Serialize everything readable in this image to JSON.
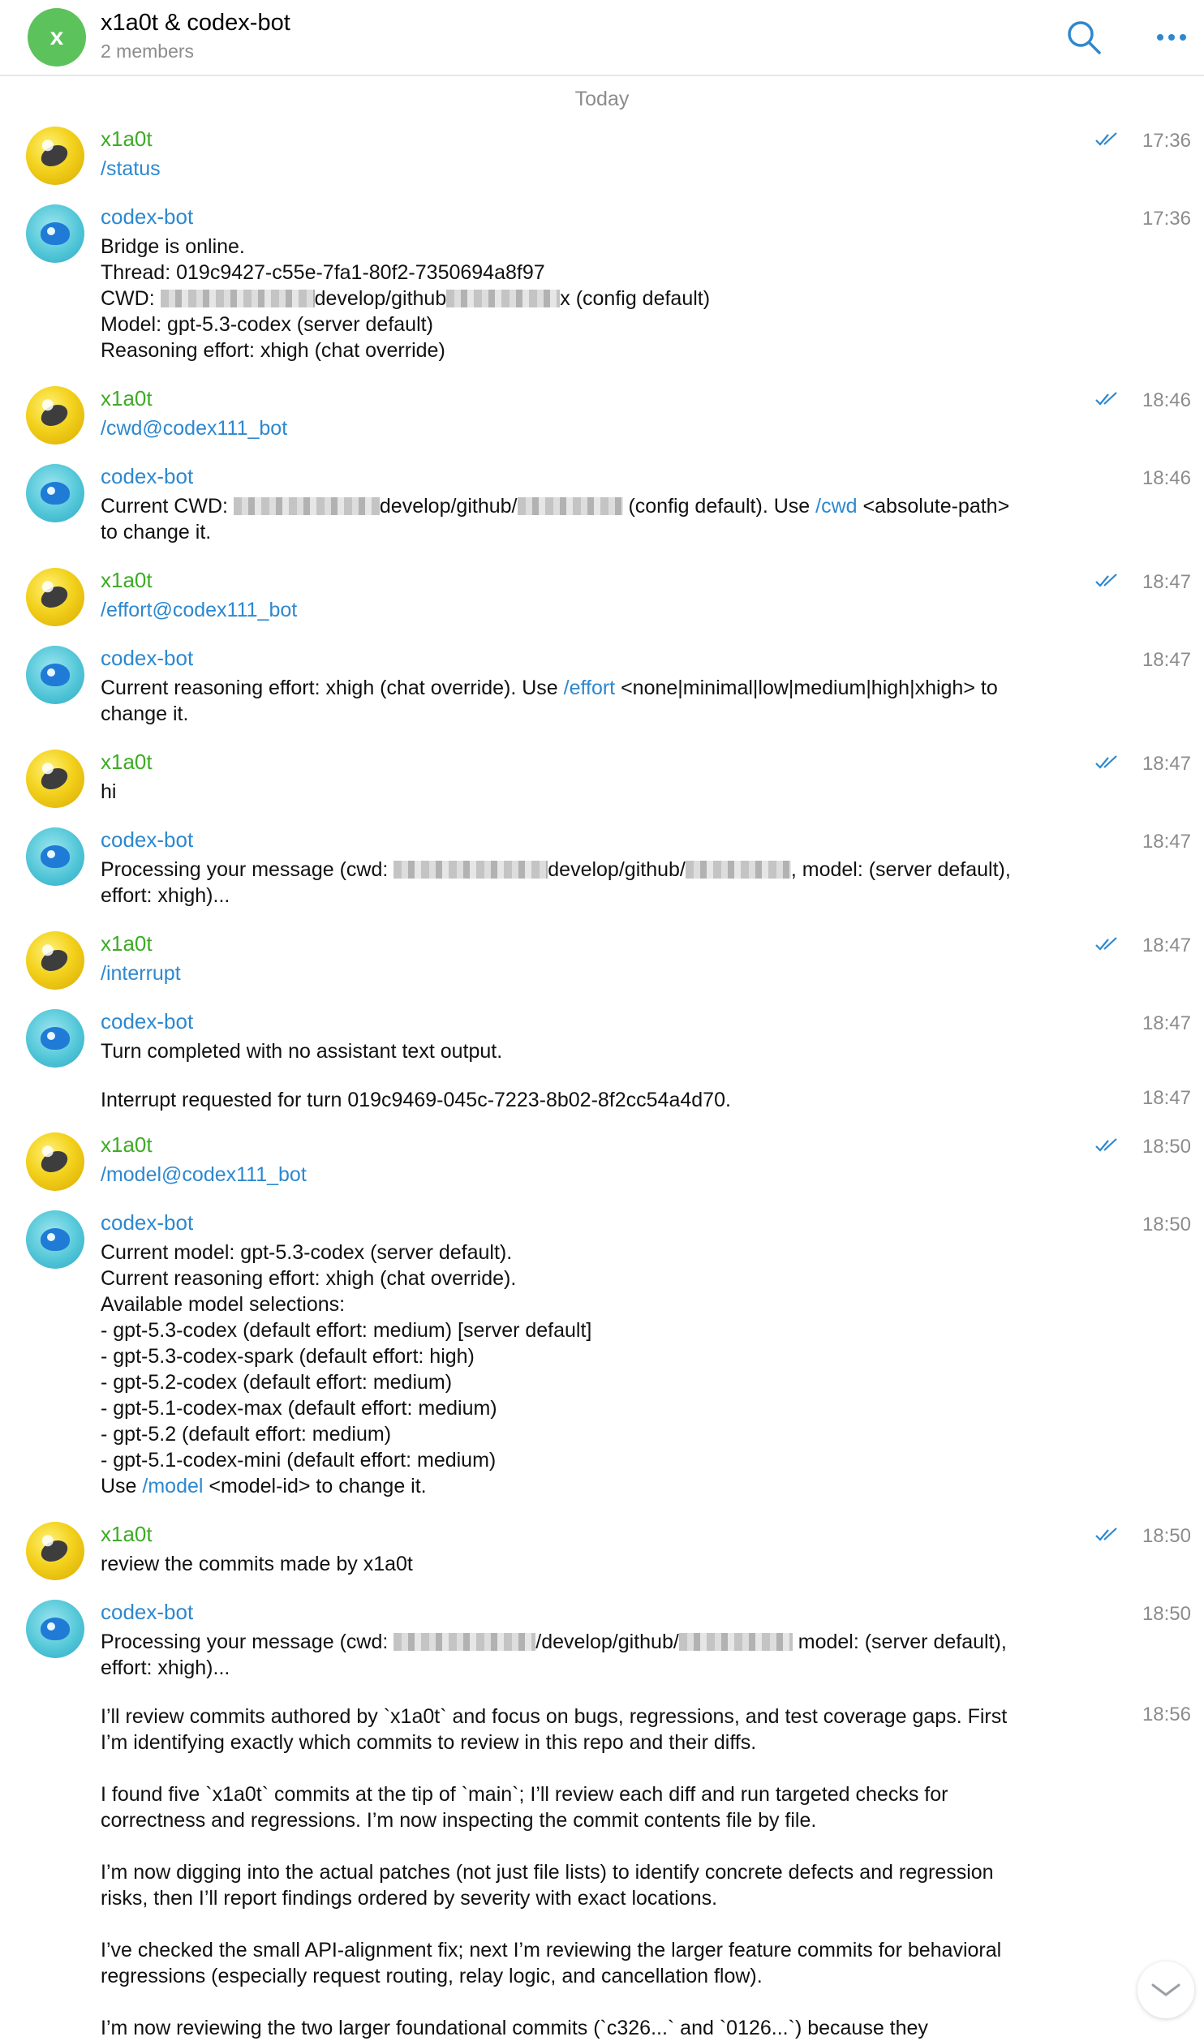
{
  "header": {
    "avatar_letter": "x",
    "title": "x1a0t & codex-bot",
    "subtitle": "2 members",
    "search_icon": "search-icon",
    "more_icon": "more-dots-icon"
  },
  "date_separator": "Today",
  "colors": {
    "user_name": "#3dab24",
    "bot_name": "#2d88cf",
    "link": "#2d88cf",
    "ticks": "#2d88cf"
  },
  "messages": [
    {
      "sender": "x1a0t",
      "time": "17:36",
      "text": "/status"
    },
    {
      "sender": "codex-bot",
      "time": "17:36",
      "l1": "Bridge is online.",
      "l2": "Thread: 019c9427-c55e-7fa1-80f2-7350694a8f97",
      "l3a": "CWD: ",
      "l3b": "develop/github",
      "l3c": "x (config default)",
      "l4": "Model: gpt-5.3-codex (server default)",
      "l5": "Reasoning effort: xhigh (chat override)"
    },
    {
      "sender": "x1a0t",
      "time": "18:46",
      "text": "/cwd@codex111_bot"
    },
    {
      "sender": "codex-bot",
      "time": "18:46",
      "a": "Current CWD: ",
      "b": "develop/github/",
      "c": " (config default). Use ",
      "link": "/cwd",
      "d": " <absolute-path>",
      "e": "to change it."
    },
    {
      "sender": "x1a0t",
      "time": "18:47",
      "text": "/effort@codex111_bot"
    },
    {
      "sender": "codex-bot",
      "time": "18:47",
      "a": "Current reasoning effort: xhigh (chat override). Use ",
      "link": "/effort",
      "b": " <none|minimal|low|medium|high|xhigh> to",
      "c": "change it."
    },
    {
      "sender": "x1a0t",
      "time": "18:47",
      "text": "hi"
    },
    {
      "sender": "codex-bot",
      "time": "18:47",
      "a": "Processing your message (cwd: ",
      "b": "develop/github/",
      "c": ", model: (server default),",
      "d": "effort: xhigh)..."
    },
    {
      "sender": "x1a0t",
      "time": "18:47",
      "text": "/interrupt"
    },
    {
      "sender": "codex-bot",
      "time": "18:47",
      "text": "Turn completed with no assistant text output."
    },
    {
      "sender": "codex-bot",
      "time": "18:47",
      "text": "Interrupt requested for turn 019c9469-045c-7223-8b02-8f2cc54a4d70."
    },
    {
      "sender": "x1a0t",
      "time": "18:50",
      "text": "/model@codex111_bot"
    },
    {
      "sender": "codex-bot",
      "time": "18:50",
      "lines": [
        "Current model: gpt-5.3-codex (server default).",
        "Current reasoning effort: xhigh (chat override).",
        "Available model selections:",
        "- gpt-5.3-codex (default effort: medium) [server default]",
        "- gpt-5.3-codex-spark (default effort: high)",
        "- gpt-5.2-codex (default effort: medium)",
        "- gpt-5.1-codex-max (default effort: medium)",
        "- gpt-5.2 (default effort: medium)",
        "- gpt-5.1-codex-mini (default effort: medium)"
      ],
      "use": "Use ",
      "link": "/model",
      "tail": " <model-id> to change it."
    },
    {
      "sender": "x1a0t",
      "time": "18:50",
      "text": "review the commits made by x1a0t"
    },
    {
      "sender": "codex-bot",
      "time": "18:50",
      "a": "Processing your message (cwd: ",
      "b": "/develop/github/",
      "c": " model: (server default),",
      "d": "effort: xhigh)..."
    },
    {
      "sender": "codex-bot",
      "time": "18:56",
      "paras": [
        "I’ll review commits authored by `x1a0t` and focus on bugs, regressions, and test coverage gaps. First\nI’m identifying exactly which commits to review in this repo and their diffs.",
        "I found five `x1a0t` commits at the tip of `main`; I’ll review each diff and run targeted checks for\ncorrectness and regressions. I’m now inspecting the commit contents file by file.",
        "I’m now digging into the actual patches (not just file lists) to identify concrete defects and regression\nrisks, then I’ll report findings ordered by severity with exact locations.",
        "I’ve checked the small API-alignment fix; next I’m reviewing the larger feature commits for behavioral\nregressions (especially request routing, relay logic, and cancellation flow).",
        "I’m now reviewing the two larger foundational commits (`c326...` and `0126...`) because they"
      ]
    }
  ],
  "scroll_icon": "chevron-down-icon"
}
